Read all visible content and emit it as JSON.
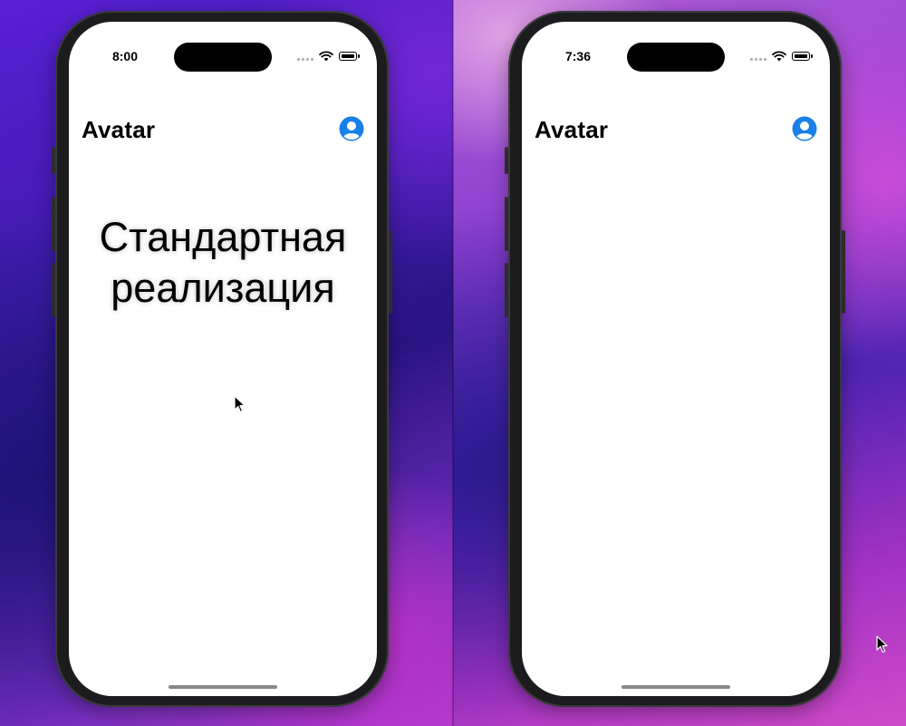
{
  "colors": {
    "accent": "#1a7fe8",
    "screen_bg": "#ffffff",
    "text": "#000000",
    "home_indicator": "#888888"
  },
  "devices": [
    {
      "status_bar": {
        "time": "8:00"
      },
      "nav": {
        "title": "Avatar",
        "avatar_icon": "person-circle-icon"
      },
      "content": {
        "line1": "Стандартная",
        "line2": "реализация"
      }
    },
    {
      "status_bar": {
        "time": "7:36"
      },
      "nav": {
        "title": "Avatar",
        "avatar_icon": "person-circle-icon"
      },
      "content": {
        "line1": "",
        "line2": ""
      }
    }
  ]
}
